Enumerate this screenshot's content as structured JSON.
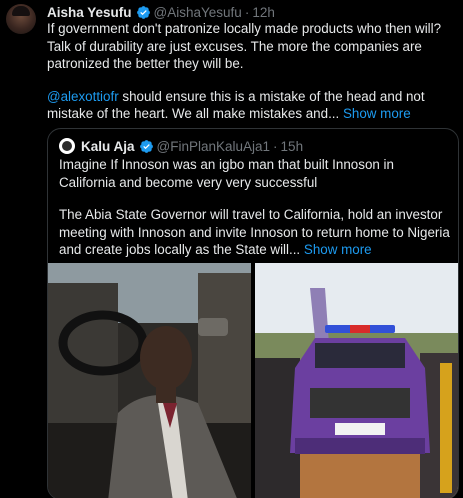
{
  "tweet": {
    "author_name": "Aisha Yesufu",
    "handle": "@AishaYesufu",
    "separator": "·",
    "time": "12h",
    "text_p1": "If government don't patronize locally made products who then will? Talk of durability are just excuses. The more the companies are patronized the better they will be.",
    "mention": "@alexottiofr",
    "text_p2_rest": " should ensure this is a mistake of the head and not mistake of the heart. We all make mistakes and... ",
    "show_more": "Show more"
  },
  "quote": {
    "author_name": "Kalu Aja",
    "handle": "@FinPlanKaluAja1",
    "separator": "·",
    "time": "15h",
    "text_p1": "Imagine If Innoson was an igbo man that built Innoson in California and become very very successful",
    "text_p2": "The Abia State Governor will travel to California, hold an investor meeting with Innoson and invite Innoson to return home to Nigeria and create jobs locally as the State will... ",
    "show_more": "Show more"
  },
  "media": [
    {
      "icon": "photo-man-in-car"
    },
    {
      "icon": "photo-purple-suv-crowd"
    }
  ],
  "colors": {
    "background": "#000000",
    "text": "#e7e9ea",
    "muted": "#71767b",
    "link": "#1d9bf0",
    "border": "#2f3336"
  }
}
